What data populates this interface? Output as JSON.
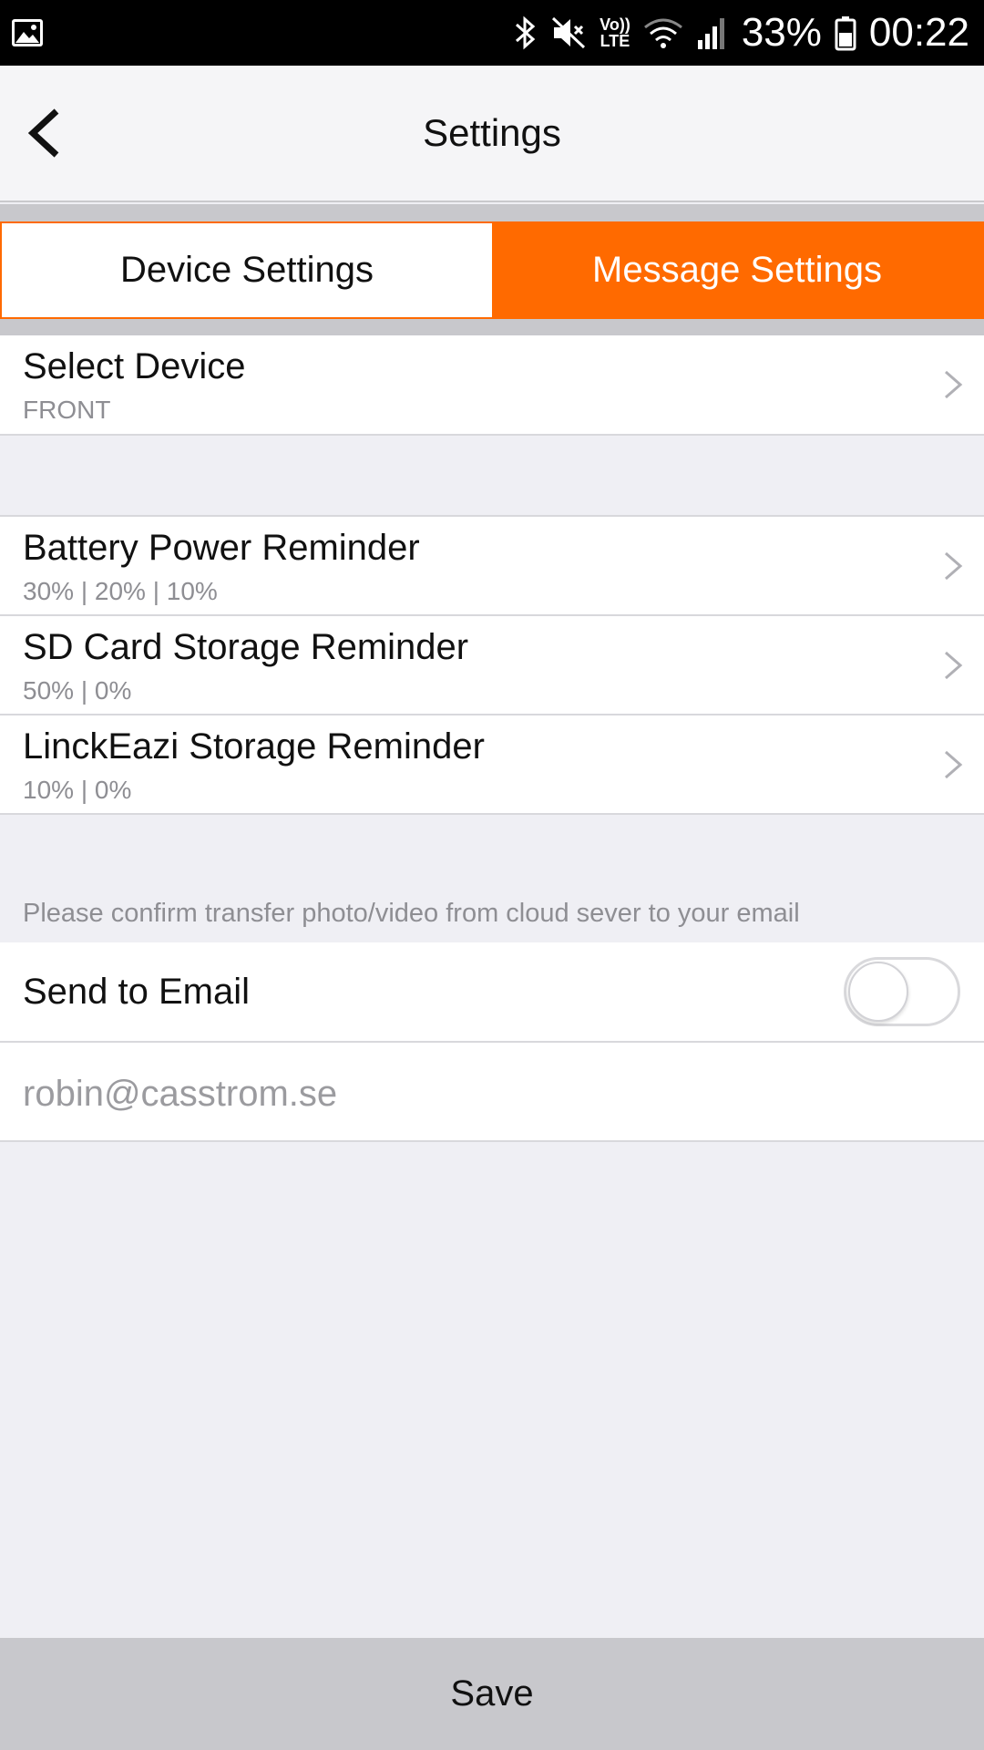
{
  "status_bar": {
    "battery_percent": "33%",
    "time": "00:22",
    "volte_top": "Vo))",
    "volte_bottom": "LTE",
    "icons": [
      "gallery-icon",
      "bluetooth-icon",
      "mute-icon",
      "volte-icon",
      "wifi-icon",
      "signal-icon",
      "battery-icon"
    ]
  },
  "header": {
    "title": "Settings",
    "back_icon": "back-chevron-icon"
  },
  "tabs": [
    {
      "label": "Device Settings",
      "active": false
    },
    {
      "label": "Message Settings",
      "active": true
    }
  ],
  "select_device": {
    "title": "Select Device",
    "value": "FRONT"
  },
  "reminders": [
    {
      "title": "Battery Power Reminder",
      "value": "30% | 20% | 10%"
    },
    {
      "title": "SD Card Storage Reminder",
      "value": "50% | 0%"
    },
    {
      "title": "LinckEazi Storage Reminder",
      "value": "10% | 0%"
    }
  ],
  "email_section": {
    "hint": "Please confirm transfer photo/video from cloud sever to your email",
    "send_to_email_label": "Send to Email",
    "send_to_email_enabled": false,
    "email_value": "robin@casstrom.se"
  },
  "footer": {
    "save_label": "Save"
  },
  "colors": {
    "accent": "#ff6a00",
    "background": "#efeff4",
    "band": "#c8c8cc"
  }
}
